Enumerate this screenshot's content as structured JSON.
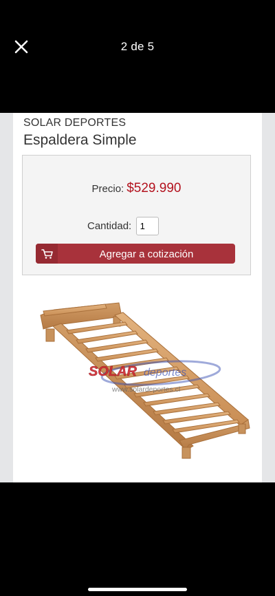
{
  "viewer": {
    "page_counter": "2 de 5"
  },
  "product": {
    "brand": "SOLAR DEPORTES",
    "title": "Espaldera Simple",
    "price_label": "Precio:",
    "price": "$529.990",
    "quantity_label": "Cantidad:",
    "quantity": "1",
    "add_button_label": "Agregar a cotización"
  },
  "image": {
    "watermark_brand": "SOLAR",
    "watermark_sub": "deportes",
    "watermark_url": "www.solardeportes.cl"
  },
  "colors": {
    "price": "#b3121e",
    "button": "#a8323b",
    "button_icon_bg": "#962a32"
  },
  "icons": {
    "close": "close-icon",
    "cart": "cart-icon"
  }
}
